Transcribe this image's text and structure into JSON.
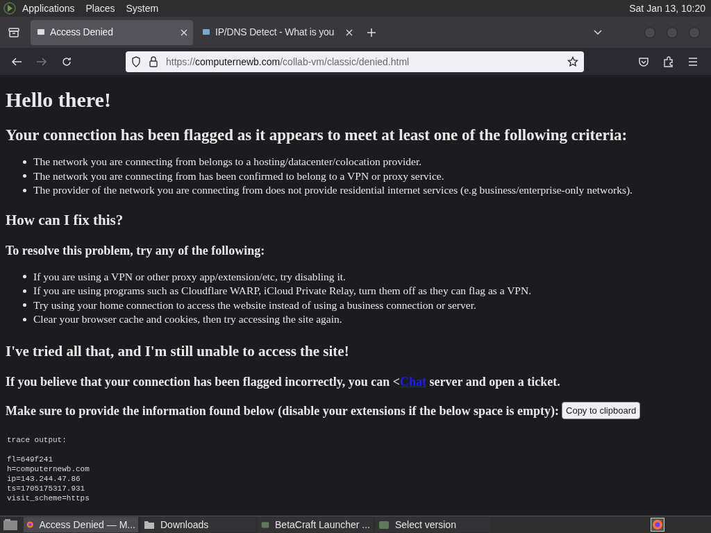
{
  "top_panel": {
    "menus": [
      "Applications",
      "Places",
      "System"
    ],
    "clock": "Sat Jan 13, 10:20"
  },
  "tabs": [
    {
      "label": "Access Denied",
      "selected": true
    },
    {
      "label": "IP/DNS Detect - What is you",
      "selected": false
    }
  ],
  "address_bar": {
    "scheme": "https://",
    "domain": "computernewb.com",
    "path": "/collab-vm/classic/denied.html"
  },
  "page": {
    "title": "Hello there!",
    "criteria_heading": "Your connection has been flagged as it appears to meet at least one of the following criteria:",
    "criteria": [
      "The network you are connecting from belongs to a hosting/datacenter/colocation provider.",
      "The network you are connecting from has been confirmed to belong to a VPN or proxy service.",
      "The provider of the network you are connecting from does not provide residential internet services (e.g business/enterprise-only networks)."
    ],
    "fix_heading": "How can I fix this?",
    "fix_intro": "To resolve this problem, try any of the following:",
    "fixes": [
      "If you are using a VPN or other proxy app/extension/etc, try disabling it.",
      "If you are using programs such as Cloudflare WARP, iCloud Private Relay, turn them off as they can flag as a VPN.",
      "Try using your home connection to access the website instead of using a business connection or server.",
      "Clear your browser cache and cookies, then try accessing the site again."
    ],
    "tried_heading": "I've tried all that, and I'm still unable to access the site!",
    "contact": {
      "before": "If you believe that your connection has been flagged incorrectly, you can <",
      "link": "Chat",
      "after": " server and open a ticket."
    },
    "provide_text": "Make sure to provide the information found below (disable your extensions if the below space is empty):",
    "copy_button": "Copy to clipboard",
    "trace_label": "trace output:",
    "trace": [
      "fl=649f241",
      "h=computernewb.com",
      "ip=143.244.47.86",
      "ts=1705175317.931",
      "visit_scheme=https"
    ]
  },
  "taskbar": [
    {
      "label": "Access Denied — M...",
      "kind": "firefox",
      "selected": true
    },
    {
      "label": "Downloads",
      "kind": "folder",
      "selected": false
    },
    {
      "label": "BetaCraft Launcher ...",
      "kind": "app",
      "selected": false
    },
    {
      "label": "Select version",
      "kind": "app",
      "selected": false
    }
  ]
}
